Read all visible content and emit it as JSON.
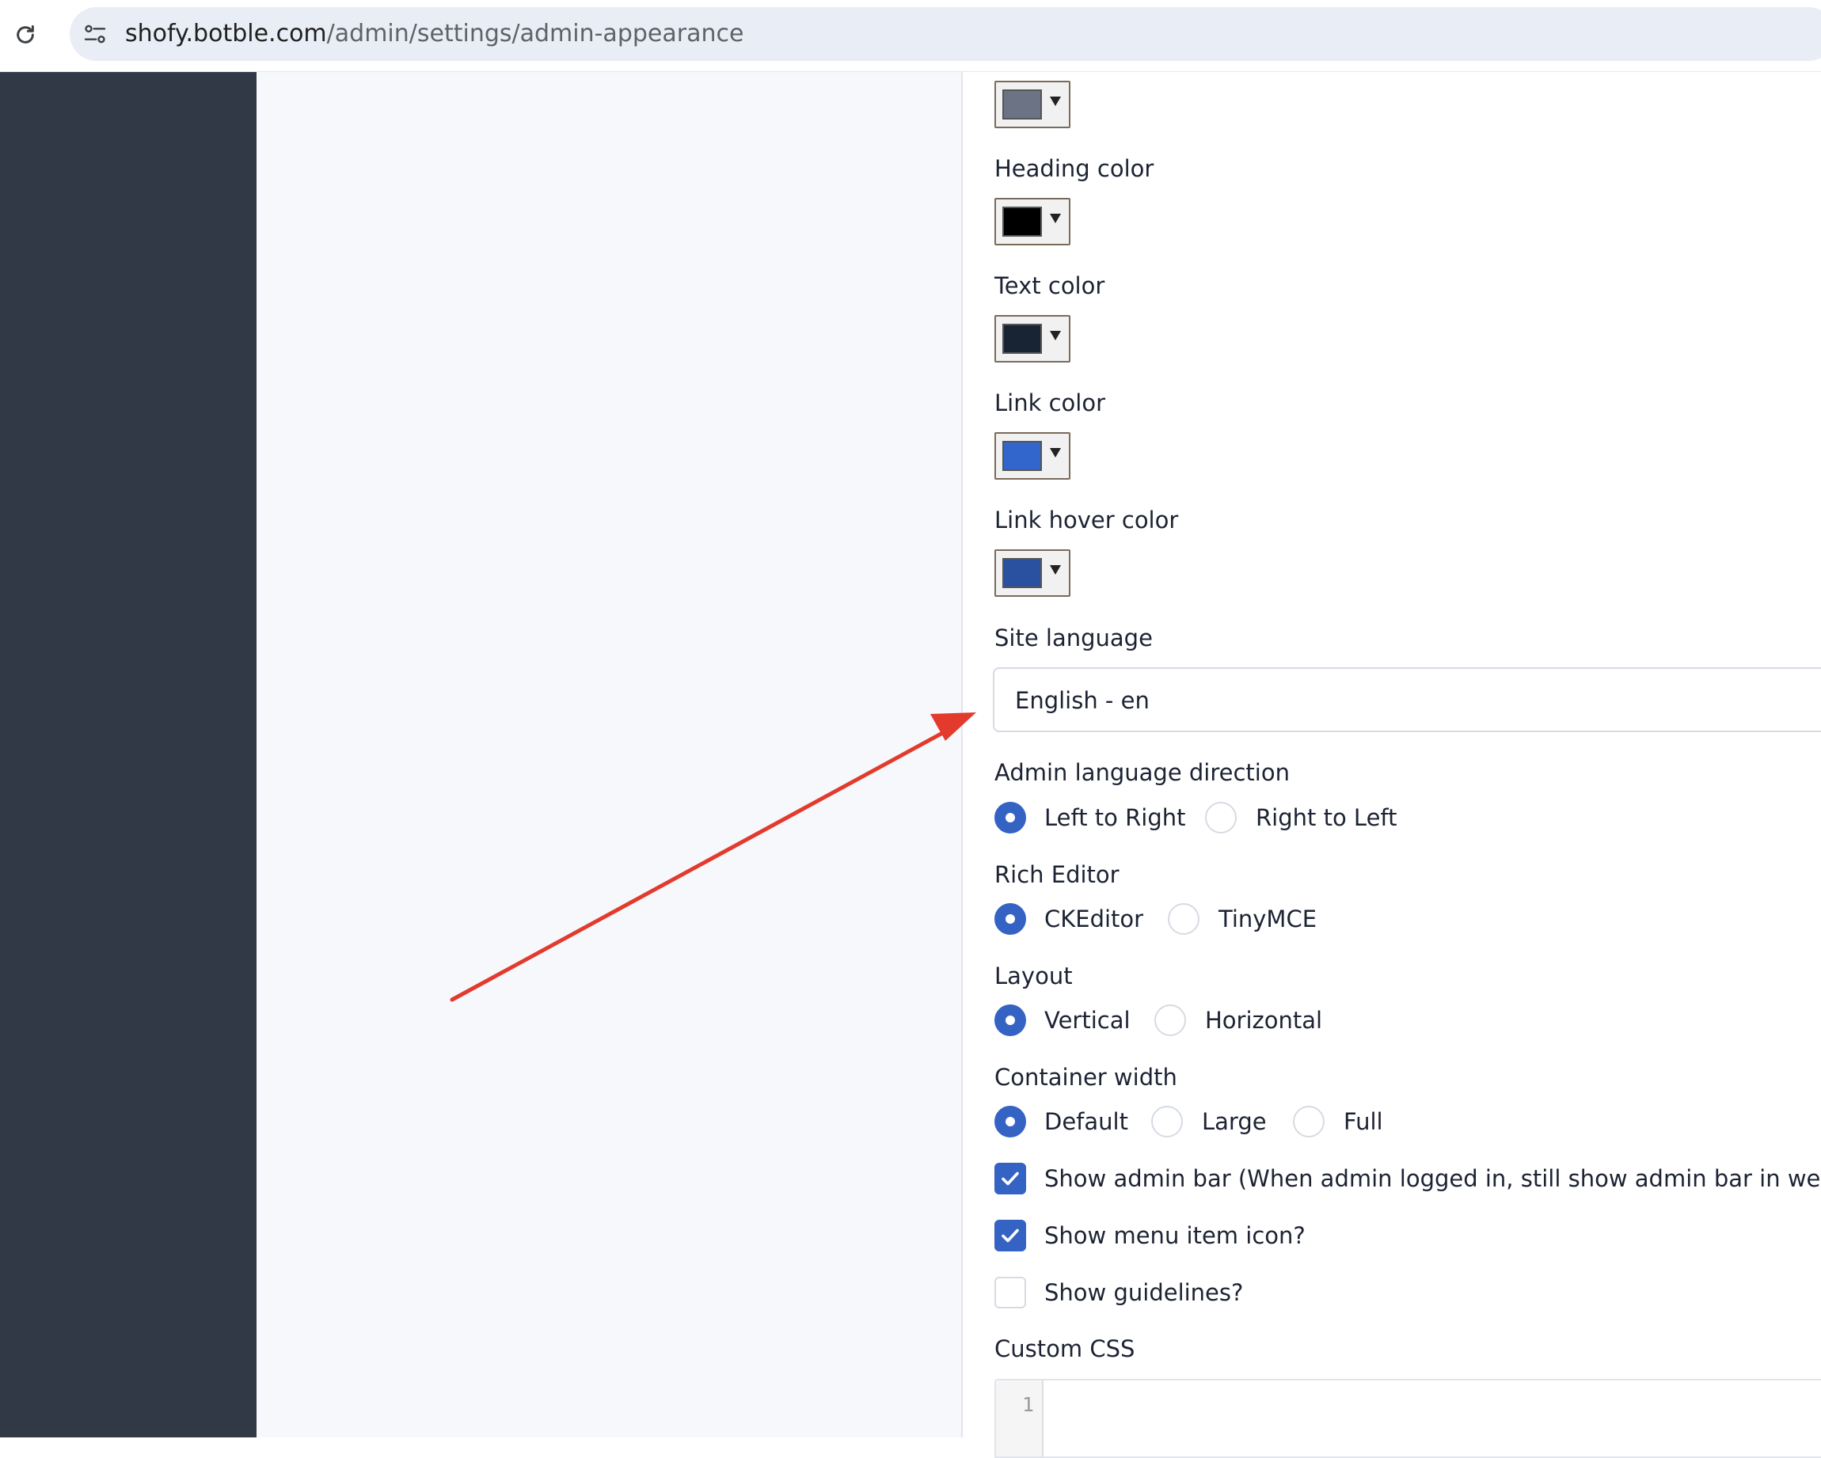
{
  "browser": {
    "url_host": "shofy.botble.com",
    "url_path": "/admin/settings/admin-appearance"
  },
  "form": {
    "heading_color_label": "Heading color",
    "text_color_label": "Text color",
    "link_color_label": "Link color",
    "link_hover_color_label": "Link hover color",
    "site_language_label": "Site language",
    "site_language_value": "English - en",
    "direction": {
      "label": "Admin language direction",
      "options": [
        "Left to Right",
        "Right to Left"
      ],
      "selected": "Left to Right"
    },
    "rich_editor": {
      "label": "Rich Editor",
      "options": [
        "CKEditor",
        "TinyMCE"
      ],
      "selected": "CKEditor"
    },
    "layout": {
      "label": "Layout",
      "options": [
        "Vertical",
        "Horizontal"
      ],
      "selected": "Vertical"
    },
    "container_width": {
      "label": "Container width",
      "options": [
        "Default",
        "Large",
        "Full"
      ],
      "selected": "Default"
    },
    "show_admin_bar": {
      "label": "Show admin bar (When admin logged in, still show admin bar in website)?",
      "checked": true
    },
    "show_menu_item_icon": {
      "label": "Show menu item icon?",
      "checked": true
    },
    "show_guidelines": {
      "label": "Show guidelines?",
      "checked": false
    },
    "custom_css_label": "Custom CSS",
    "code_line_number": "1"
  },
  "colors": {
    "previous_color": "#6b7385",
    "heading_color": "#000000",
    "text_color": "#182433",
    "link_color": "#3366cc",
    "link_hover_color": "#2a519f",
    "accent": "#3463c4",
    "sidebar": "#313846",
    "annotation_arrow": "#e23b2e"
  }
}
